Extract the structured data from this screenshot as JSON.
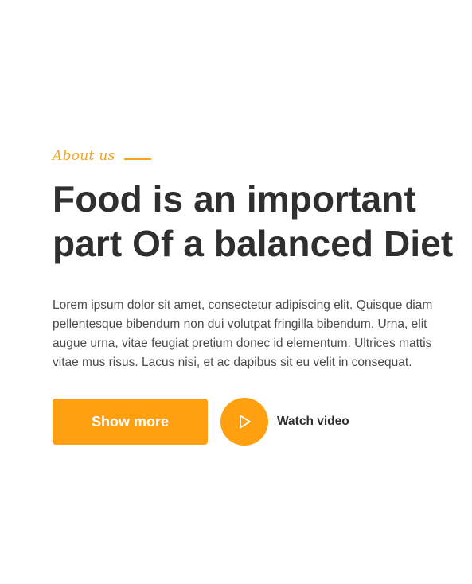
{
  "about": {
    "eyebrow": "About us",
    "headline_line1": "Food is an important",
    "headline_line2": "part Of a balanced Diet",
    "body": "Lorem ipsum dolor sit amet, consectetur adipiscing elit. Quisque diam pellentesque bibendum non dui volutpat fringilla bibendum. Urna, elit augue urna, vitae feugiat pretium donec id elementum. Ultrices mattis vitae mus risus. Lacus nisi, et ac dapibus sit eu velit in consequat."
  },
  "actions": {
    "show_more_label": "Show more",
    "watch_video_label": "Watch video",
    "watch_video_icon": "play-icon"
  },
  "colors": {
    "accent": "#ffa011",
    "eyebrow": "#f4a51c",
    "heading": "#2f2f2f",
    "body_text": "#4a4a4a",
    "background": "#ffffff"
  }
}
